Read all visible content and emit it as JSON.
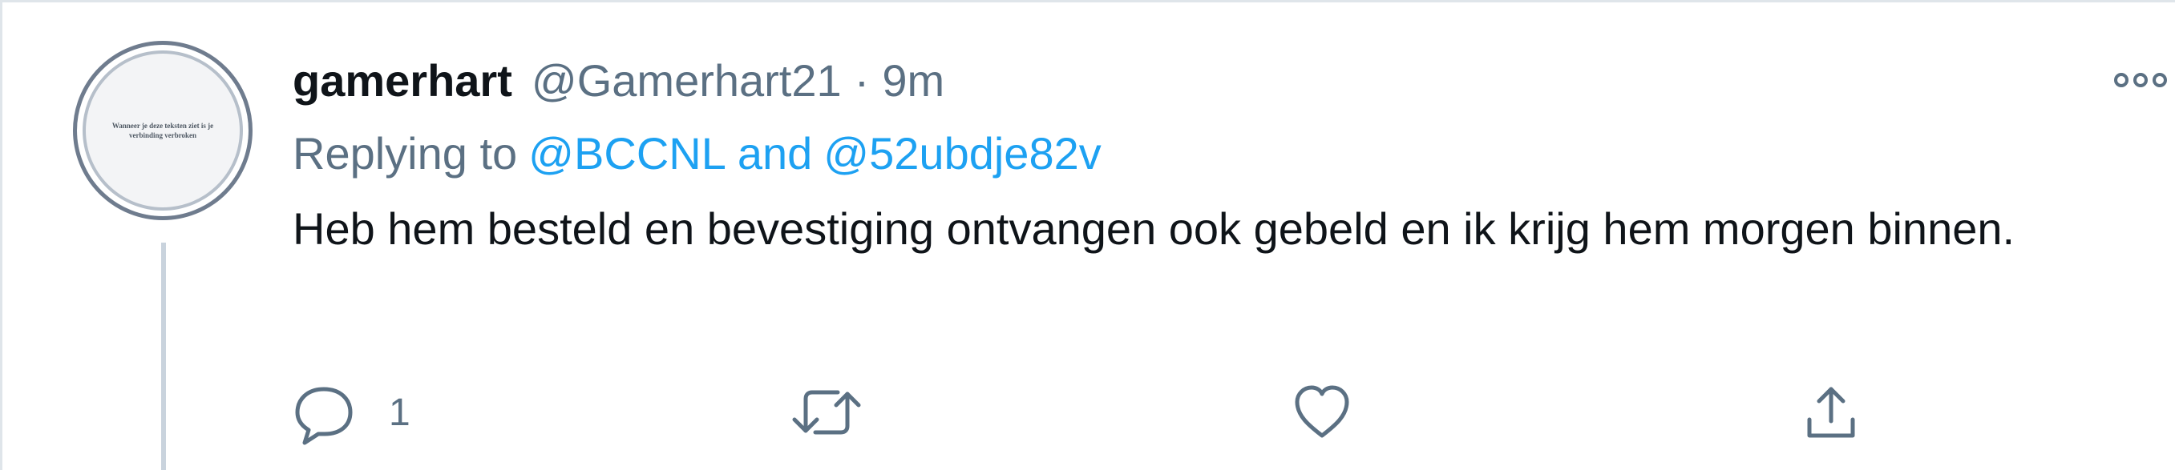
{
  "tweet": {
    "author": {
      "name": "gamerhart",
      "handle": "@Gamerhart21",
      "time": "9m",
      "separator": "·",
      "avatar_text": "Wanneer je deze teksten ziet is je verbinding verbroken"
    },
    "reply": {
      "prefix": "Replying to",
      "mentions": [
        "@BCCNL",
        "@52ubdje82v"
      ],
      "conjunction": "and"
    },
    "text": "Heb hem besteld en bevestiging ontvangen ook gebeld en ik krijg hem morgen binnen.",
    "actions": {
      "reply_icon": "reply-icon",
      "reply_count": "1",
      "retweet_icon": "retweet-icon",
      "like_icon": "like-icon",
      "share_icon": "share-icon"
    },
    "more_icon": "more-icon"
  },
  "colors": {
    "text": "#0f1419",
    "secondary": "#5b7083",
    "link": "#1da1f2",
    "border": "#dfe5ea",
    "thread_line": "#c9d3dd"
  }
}
